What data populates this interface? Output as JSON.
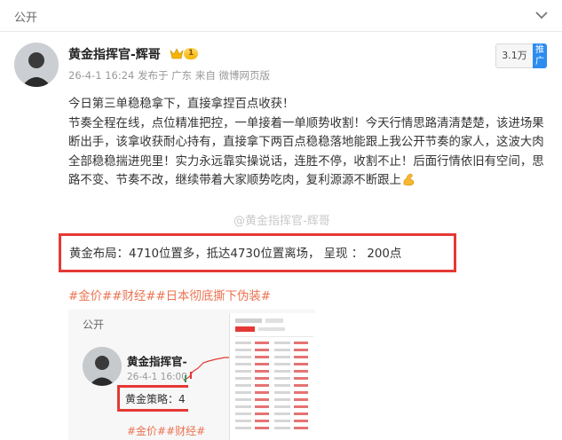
{
  "header": {
    "title": "公开"
  },
  "post": {
    "username": "黄金指挥官-辉哥",
    "level_badge": "1",
    "meta": "26-4-1 16:24  发布于 广东  来自 微博网页版",
    "follower_count": "3.1万",
    "promo_tag": "推广",
    "content_line1": "今日第三单稳稳拿下，直接拿捏百点收获！",
    "content_body": "节奏全程在线，点位精准把控，一单接着一单顺势收割！今天行情思路清清楚楚，该进场果断出手，该拿收获耐心持有，直接拿下两百点稳稳落地能跟上我公开节奏的家人，这波大肉全部稳稳揣进兜里！实力永远靠实操说话，连胜不停，收割不止！后面行情依旧有空间，思路不变、节奏不改，继续带着大家顺势吃肉，复利源源不断跟上",
    "watermark": "@黄金指挥官-辉哥",
    "highlight": "黄金布局：4710位置多，抵达4730位置离场， 呈现 ： 200点",
    "tags": "#金价##财经##日本彻底撕下伪装#"
  },
  "repost": {
    "title": "公开",
    "username": "黄金指挥官-",
    "meta": "26-4-1 16:00",
    "strategy": "黄金策略：4",
    "tags": "#金价##财经#"
  },
  "colors": {
    "highlight_border": "#e53935",
    "tag": "#eb7350",
    "promo": "#2d8cf0"
  }
}
